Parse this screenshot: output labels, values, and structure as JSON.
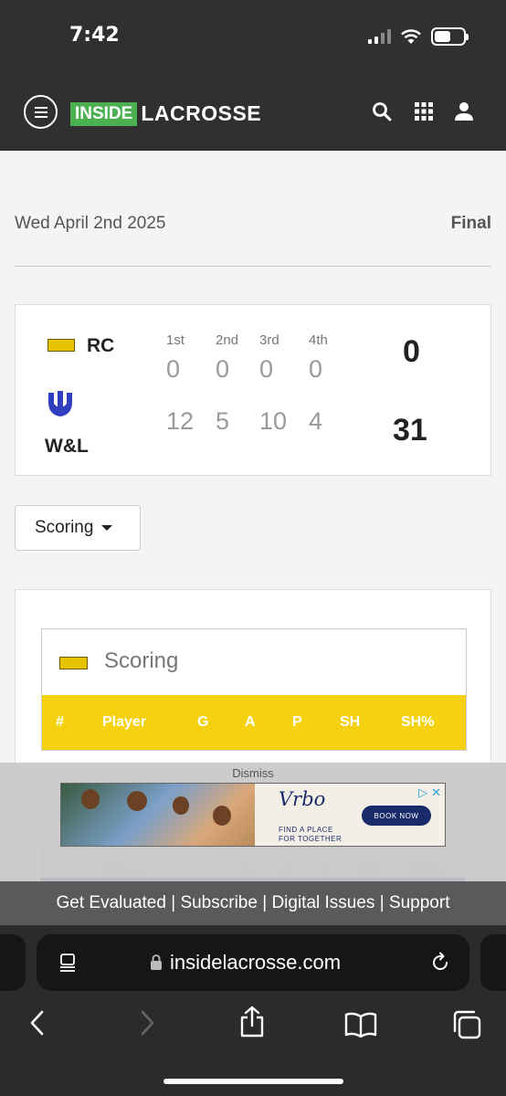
{
  "status": {
    "time": "7:42",
    "icons": [
      "signal-icon",
      "wifi-icon",
      "battery-icon"
    ],
    "battery_level": 0.55
  },
  "nav": {
    "logo_inside": "INSIDE",
    "logo_lacrosse": "LACROSSE",
    "icons": [
      "menu-icon",
      "search-icon",
      "grid-icon",
      "user-icon"
    ]
  },
  "game": {
    "date": "Wed April 2nd 2025",
    "status": "Final",
    "quarters": [
      "1st",
      "2nd",
      "3rd",
      "4th"
    ],
    "teams": [
      {
        "abbr": "RC",
        "scores": [
          "0",
          "0",
          "0",
          "0"
        ],
        "total": "0"
      },
      {
        "abbr": "W&L",
        "scores": [
          "12",
          "5",
          "10",
          "4"
        ],
        "total": "31"
      }
    ]
  },
  "stat_select": {
    "selected": "Scoring"
  },
  "stats": {
    "title": "Scoring",
    "columns": [
      "#",
      "Player",
      "G",
      "A",
      "P",
      "SH",
      "SH%"
    ],
    "header_color": "#f5d10f",
    "secondary_color": "#1c3a8c"
  },
  "ad": {
    "dismiss": "Dismiss",
    "brand": "Vrbo",
    "tagline_1": "FIND A PLACE",
    "tagline_2": "FOR TOGETHER",
    "cta": "BOOK NOW"
  },
  "footer": {
    "links": [
      "Get Evaluated",
      "Subscribe",
      "Digital Issues",
      "Support"
    ],
    "separator": "|"
  },
  "browser": {
    "url": "insidelacrosse.com",
    "icons": [
      "reader-icon",
      "lock-icon",
      "reload-icon",
      "back-icon",
      "forward-icon",
      "share-icon",
      "bookmarks-icon",
      "tabs-icon"
    ]
  }
}
